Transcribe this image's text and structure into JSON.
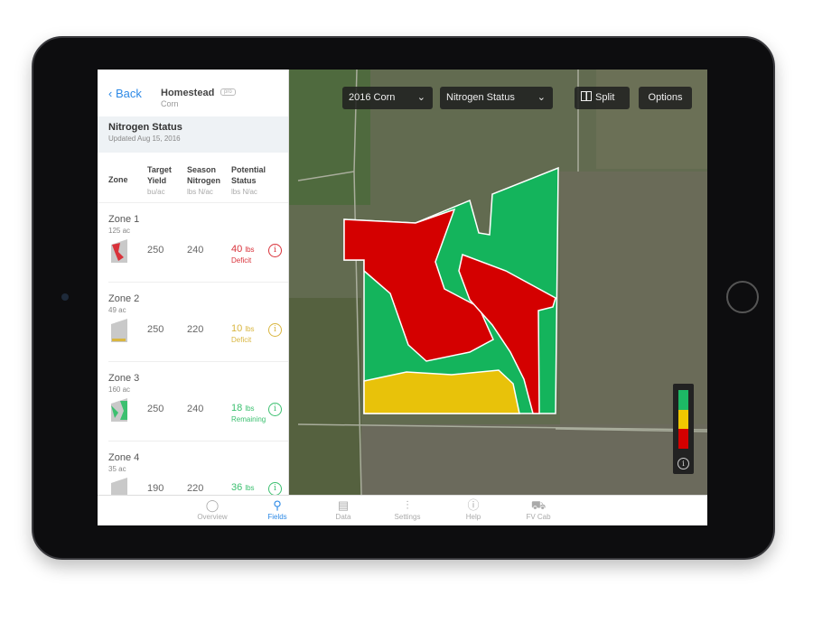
{
  "panel": {
    "back_label": "Back",
    "field_name": "Homestead",
    "crop": "Corn",
    "badge": "pro",
    "section_title": "Nitrogen Status",
    "updated": "Updated Aug 15, 2016",
    "columns": {
      "zone": "Zone",
      "target": "Target",
      "yield": "Yield",
      "yield_unit": "bu/ac",
      "season": "Season",
      "nitrogen": "Nitrogen",
      "nitrogen_unit": "lbs N/ac",
      "potential": "Potential",
      "status": "Status",
      "status_unit": "lbs N/ac"
    },
    "zones": [
      {
        "name": "Zone 1",
        "acres": "125 ac",
        "target": "250",
        "season": "240",
        "amount": "40",
        "unit": "lbs",
        "label": "Deficit",
        "color": "#d9323a"
      },
      {
        "name": "Zone 2",
        "acres": "49 ac",
        "target": "250",
        "season": "220",
        "amount": "10",
        "unit": "lbs",
        "label": "Deficit",
        "color": "#d9b640"
      },
      {
        "name": "Zone 3",
        "acres": "160 ac",
        "target": "250",
        "season": "240",
        "amount": "18",
        "unit": "lbs",
        "label": "Remaining",
        "color": "#3cc070"
      },
      {
        "name": "Zone 4",
        "acres": "35 ac",
        "target": "190",
        "season": "220",
        "amount": "36",
        "unit": "lbs",
        "label": "",
        "color": "#3cc070"
      }
    ]
  },
  "map": {
    "season_select": "2016 Corn",
    "layer_select": "Nitrogen Status",
    "split_label": "Split",
    "options_label": "Options",
    "legend_colors": [
      "#1db865",
      "#f0c800",
      "#d40000"
    ],
    "zone_colors": {
      "red": "#d40000",
      "green": "#14b45c",
      "yellow": "#e8c20a"
    }
  },
  "tabs": [
    {
      "label": "Overview",
      "icon": "circle-icon"
    },
    {
      "label": "Fields",
      "icon": "fields-icon",
      "active": true
    },
    {
      "label": "Data",
      "icon": "data-icon"
    },
    {
      "label": "Settings",
      "icon": "sliders-icon"
    },
    {
      "label": "Help",
      "icon": "info-icon"
    },
    {
      "label": "FV Cab",
      "icon": "tractor-icon"
    }
  ]
}
